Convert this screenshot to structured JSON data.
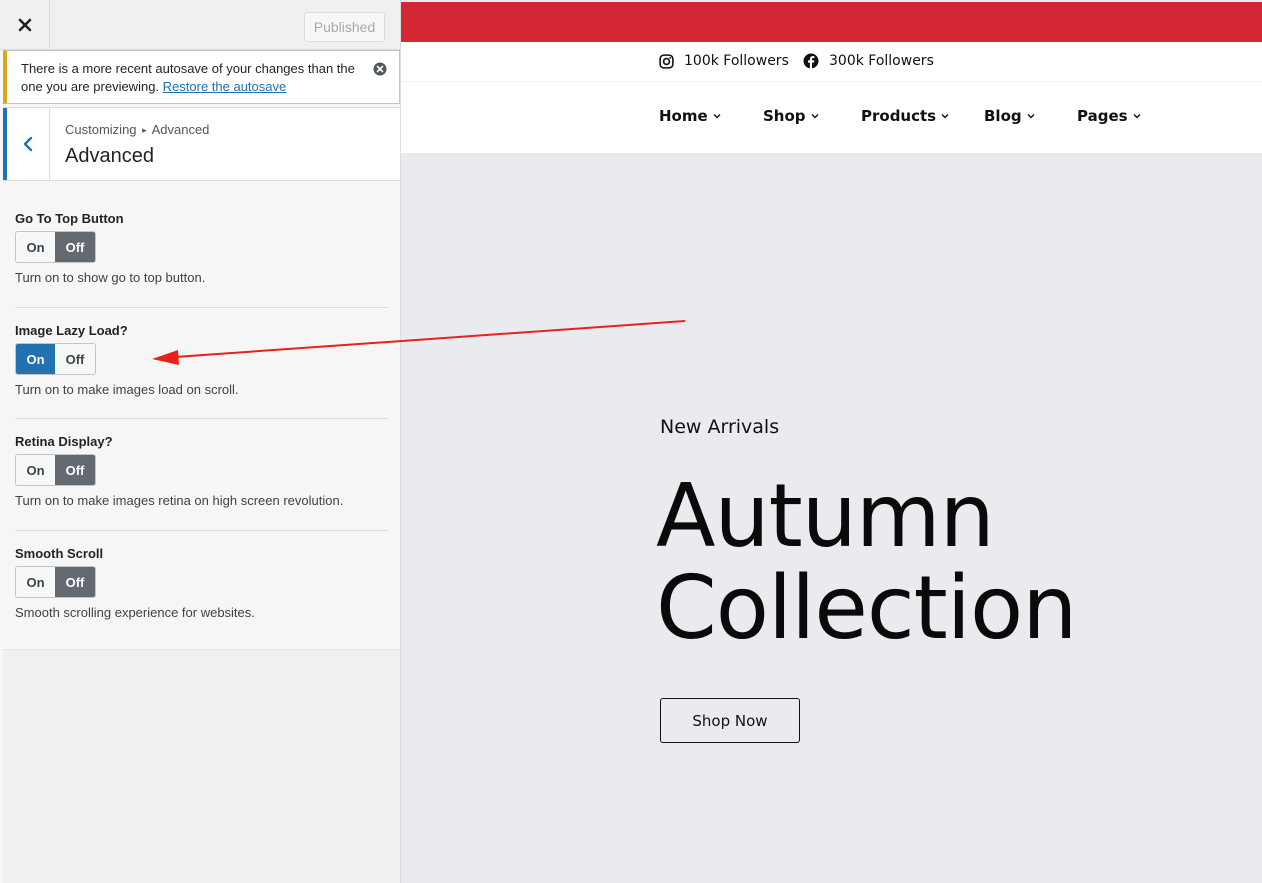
{
  "header": {
    "close_icon": "close-icon",
    "published_label": "Published"
  },
  "notice": {
    "text": "There is a more recent autosave of your changes than the one you are previewing.",
    "link": "Restore the autosave"
  },
  "section": {
    "breadcrumb_root": "Customizing",
    "breadcrumb_separator": "▸",
    "breadcrumb_current": "Advanced",
    "title": "Advanced"
  },
  "controls": [
    {
      "label": "Go To Top Button",
      "on_label": "On",
      "off_label": "Off",
      "value": "Off",
      "description": "Turn on to show go to top button."
    },
    {
      "label": "Image Lazy Load?",
      "on_label": "On",
      "off_label": "Off",
      "value": "On",
      "description": "Turn on to make images load on scroll."
    },
    {
      "label": "Retina Display?",
      "on_label": "On",
      "off_label": "Off",
      "value": "Off",
      "description": "Turn on to make images retina on high screen revolution."
    },
    {
      "label": "Smooth Scroll",
      "on_label": "On",
      "off_label": "Off",
      "value": "Off",
      "description": "Smooth scrolling experience for websites."
    }
  ],
  "preview": {
    "social": [
      {
        "icon": "instagram-icon",
        "text": "100k Followers"
      },
      {
        "icon": "facebook-icon",
        "text": "300k Followers"
      }
    ],
    "nav": [
      "Home",
      "Shop",
      "Products",
      "Blog",
      "Pages"
    ],
    "hero": {
      "kicker": "New Arrivals",
      "title_line1": "Autumn",
      "title_line2": "Collection",
      "button": "Shop Now"
    }
  },
  "colors": {
    "accent_blue": "#2271b1",
    "topbar_red": "#d32734",
    "notice_border": "#dba617",
    "arrow_red": "#e8211b"
  }
}
